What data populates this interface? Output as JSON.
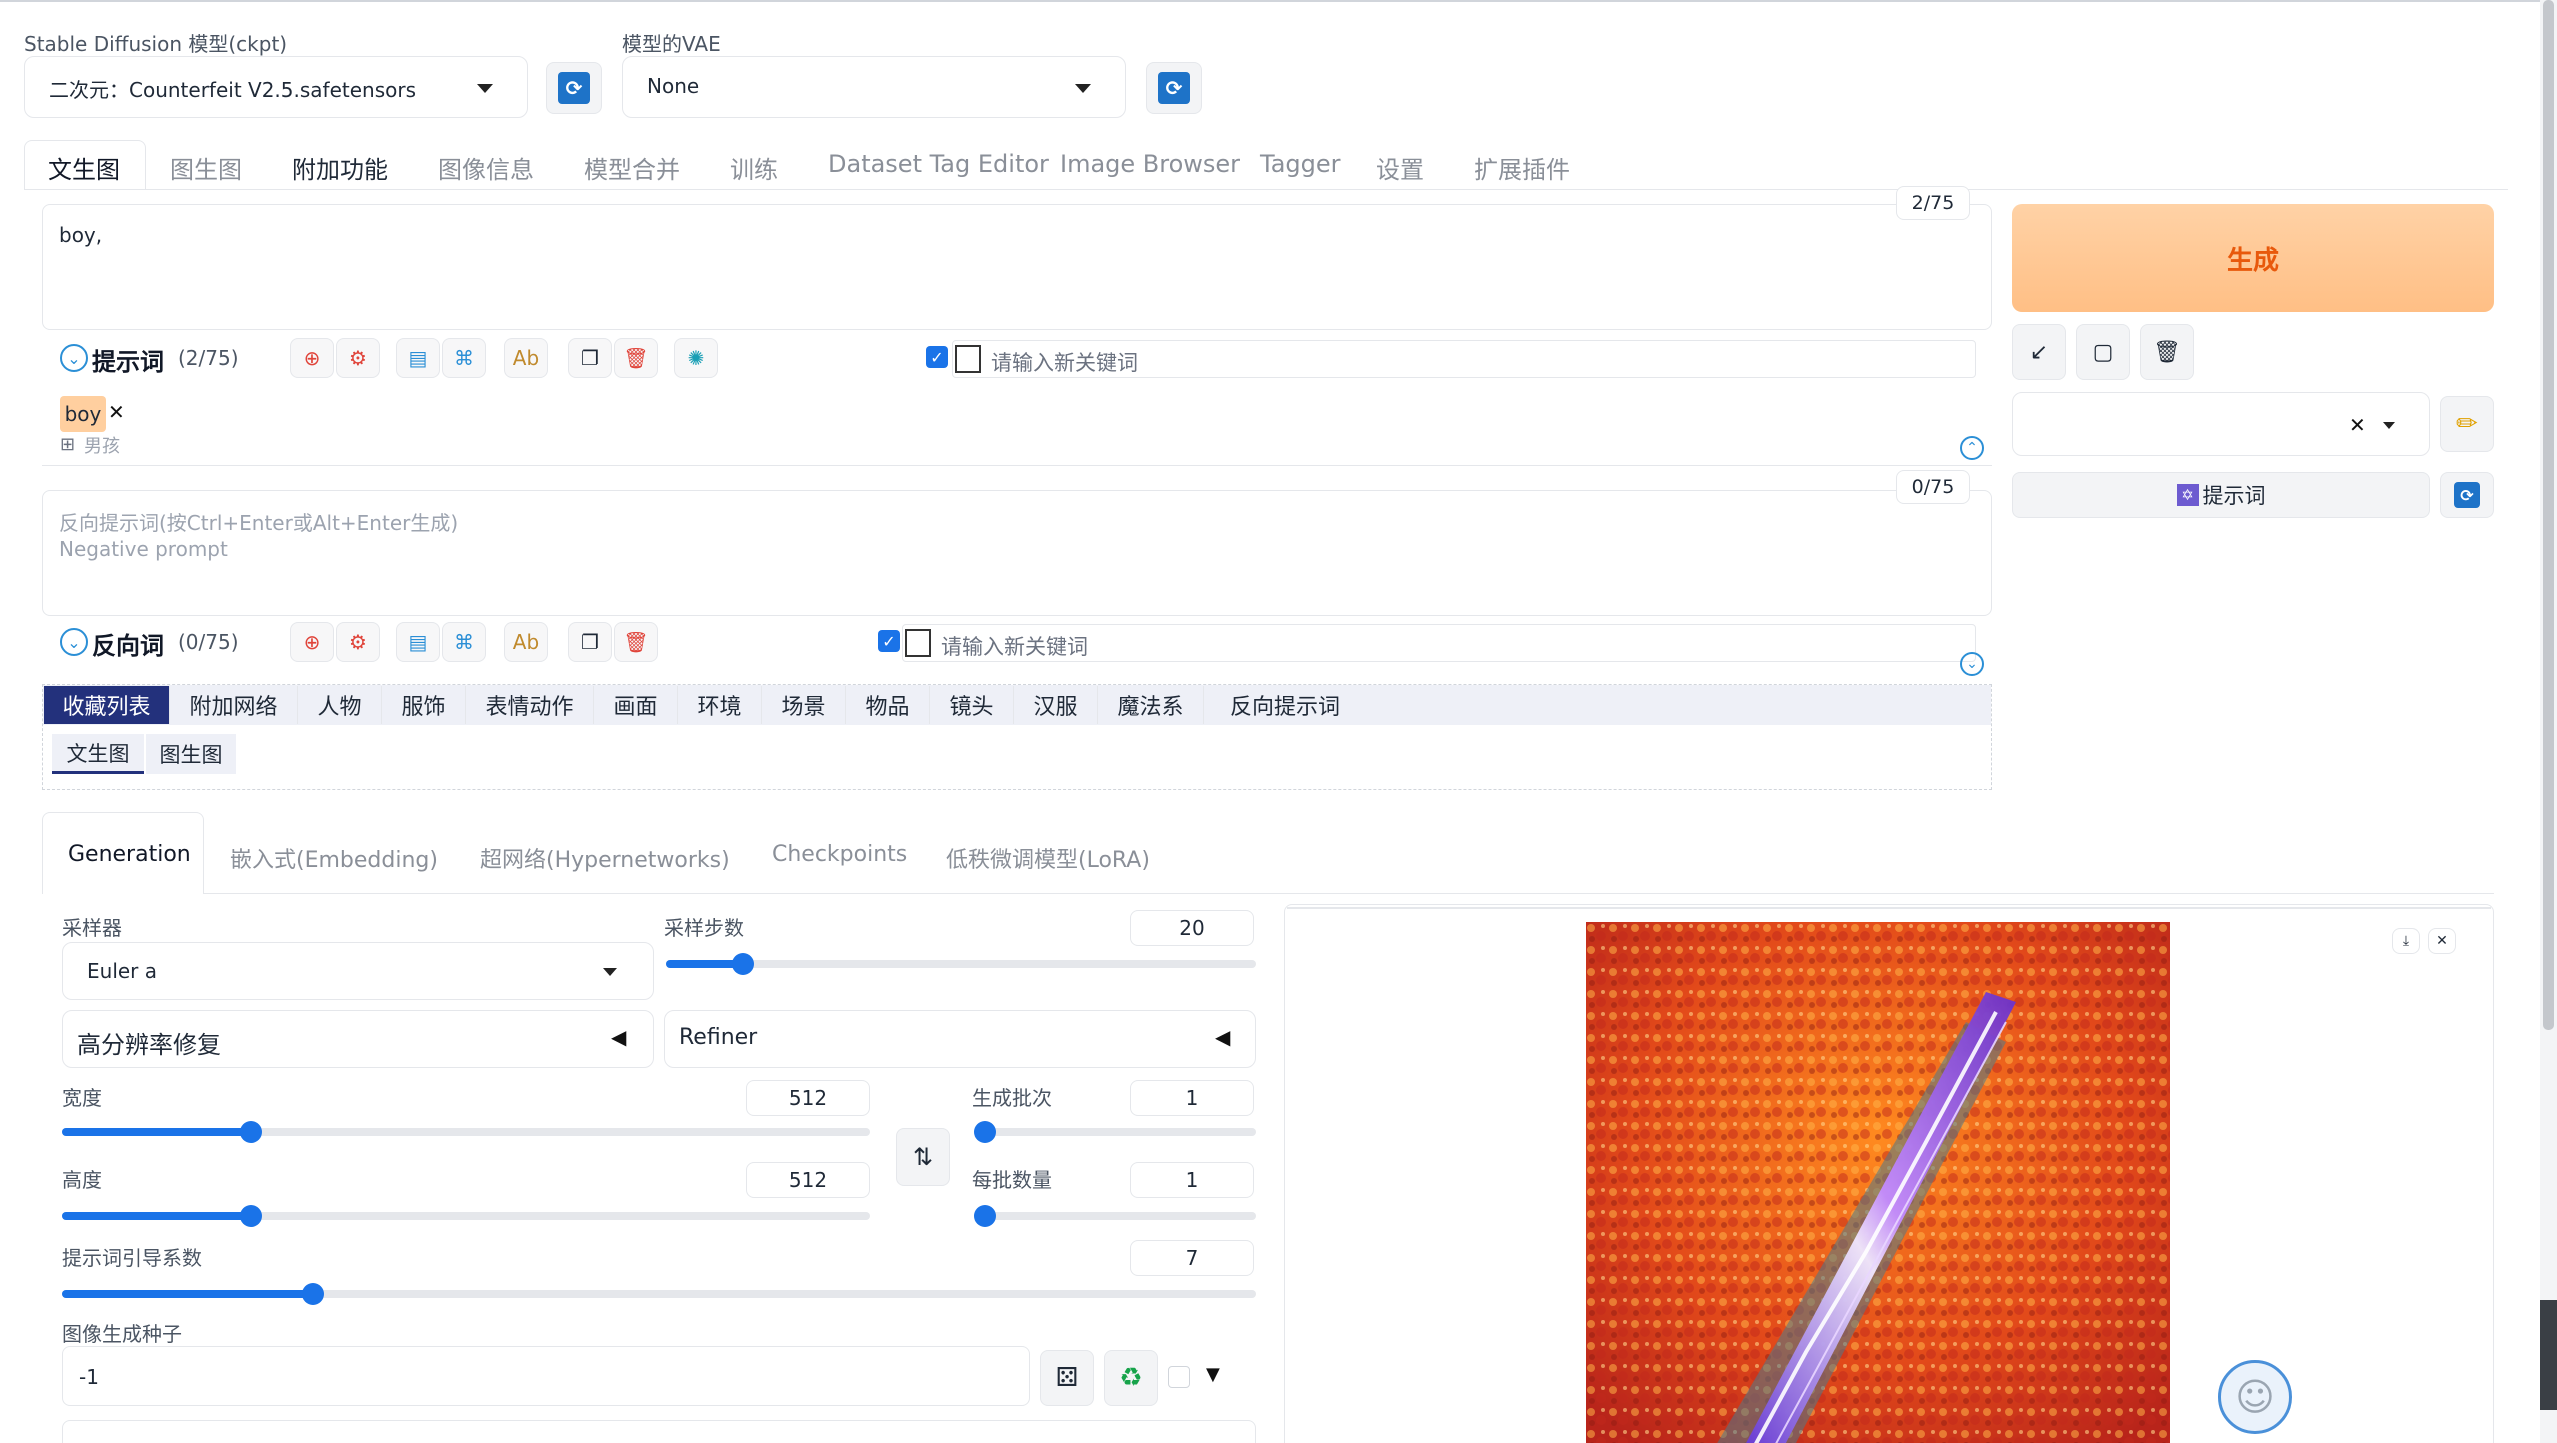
{
  "model": {
    "ckpt_label": "Stable Diffusion 模型(ckpt)",
    "ckpt_value": "二次元：Counterfeit V2.5.safetensors",
    "vae_label": "模型的VAE",
    "vae_value": "None"
  },
  "tabs": [
    "文生图",
    "图生图",
    "附加功能",
    "图像信息",
    "模型合并",
    "训练",
    "Dataset Tag Editor",
    "Image Browser",
    "Tagger",
    "设置",
    "扩展插件"
  ],
  "prompt": {
    "text": "boy,",
    "counter": "2/75",
    "toolbar_label": "提示词",
    "toolbar_count": "(2/75)",
    "keyword_placeholder": "请输入新关键词",
    "tag_en": "boy",
    "tag_cn": "男孩"
  },
  "negative": {
    "placeholder_line1": "反向提示词(按Ctrl+Enter或Alt+Enter生成)",
    "placeholder_line2": "Negative prompt",
    "counter": "0/75",
    "toolbar_label": "反向词",
    "toolbar_count": "(0/75)",
    "keyword_placeholder": "请输入新关键词"
  },
  "categories": [
    "收藏列表",
    "附加网络",
    "人物",
    "服饰",
    "表情动作",
    "画面",
    "环境",
    "场景",
    "物品",
    "镜头",
    "汉服",
    "魔法系",
    "反向提示词"
  ],
  "subtabs": [
    "文生图",
    "图生图"
  ],
  "generate": {
    "button_label": "生成",
    "prompt_button_label": "提示词"
  },
  "gen_tabs": [
    "Generation",
    "嵌入式(Embedding)",
    "超网络(Hypernetworks)",
    "Checkpoints",
    "低秩微调模型(LoRA)"
  ],
  "params": {
    "sampler_label": "采样器",
    "sampler_value": "Euler a",
    "steps_label": "采样步数",
    "steps_value": "20",
    "hires_label": "高分辨率修复",
    "refiner_label": "Refiner",
    "width_label": "宽度",
    "width_value": "512",
    "height_label": "高度",
    "height_value": "512",
    "batch_count_label": "生成批次",
    "batch_count_value": "1",
    "batch_size_label": "每批数量",
    "batch_size_value": "1",
    "cfg_label": "提示词引导系数",
    "cfg_value": "7",
    "seed_label": "图像生成种子",
    "seed_value": "-1"
  },
  "slider_levels": {
    "steps": 0.13,
    "width": 0.234,
    "height": 0.234,
    "batch_count": 0.0,
    "batch_size": 0.0,
    "cfg": 0.21
  },
  "colors": {
    "generate_bg": "#ffc48a",
    "generate_text": "#e8590c",
    "accent_blue": "#1a73e8",
    "category_active": "#23317c"
  }
}
